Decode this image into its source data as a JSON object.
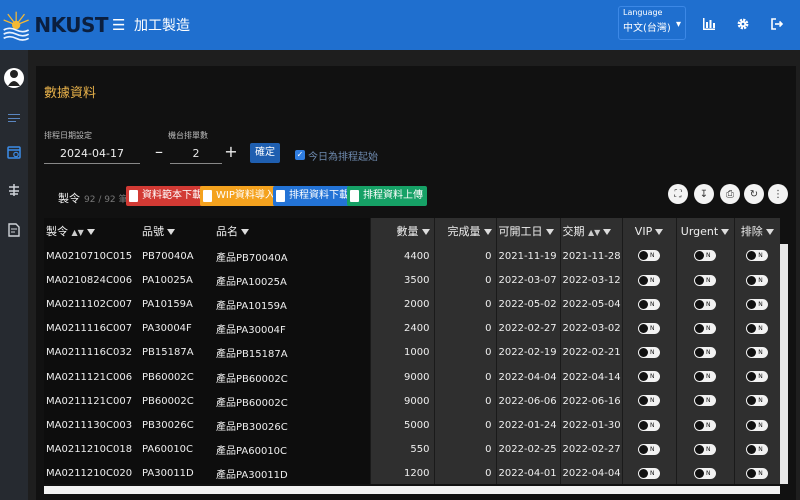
{
  "header": {
    "brand": "NKUST",
    "app_title": "加工製造",
    "language_label": "Language",
    "language_value": "中文(台灣)",
    "icons": [
      "menu-icon",
      "bar-chart-icon",
      "gear-icon",
      "logout-icon"
    ]
  },
  "sidebar": {
    "items": [
      "avatar",
      "list-icon",
      "calendar-icon",
      "adjust-icon",
      "document-icon"
    ]
  },
  "page": {
    "title": "數據資料",
    "date_label": "排程日期設定",
    "date_value": "2024-04-17",
    "machine_label": "機台排單數",
    "machine_value": "2",
    "confirm_label": "確定",
    "checkbox_label": "今日為排程起始",
    "checkbox_checked": true
  },
  "toolbar": {
    "title": "製令",
    "count": "92 / 92 筆",
    "buttons": [
      "資料範本下載",
      "WIP資料導入",
      "排程資料下載",
      "排程資料上傳"
    ]
  },
  "table": {
    "columns": [
      "製令",
      "品號",
      "品名",
      "數量",
      "完成量",
      "可開工日",
      "交期",
      "VIP",
      "Urgent",
      "排除"
    ],
    "toggle_text": "N",
    "rows": [
      [
        "MA0210710C015",
        "PB70040A",
        "產品PB70040A",
        "4400",
        "0",
        "2021-11-19",
        "2021-11-28"
      ],
      [
        "MA0210824C006",
        "PA10025A",
        "產品PA10025A",
        "3500",
        "0",
        "2022-03-07",
        "2022-03-12"
      ],
      [
        "MA0211102C007",
        "PA10159A",
        "產品PA10159A",
        "2000",
        "0",
        "2022-05-02",
        "2022-05-04"
      ],
      [
        "MA0211116C007",
        "PA30004F",
        "產品PA30004F",
        "2400",
        "0",
        "2022-02-27",
        "2022-03-02"
      ],
      [
        "MA0211116C032",
        "PB15187A",
        "產品PB15187A",
        "1000",
        "0",
        "2022-02-19",
        "2022-02-21"
      ],
      [
        "MA0211121C006",
        "PB60002C",
        "產品PB60002C",
        "9000",
        "0",
        "2022-04-04",
        "2022-04-14"
      ],
      [
        "MA0211121C007",
        "PB60002C",
        "產品PB60002C",
        "9000",
        "0",
        "2022-06-06",
        "2022-06-16"
      ],
      [
        "MA0211130C003",
        "PB30026C",
        "產品PB30026C",
        "5000",
        "0",
        "2022-01-24",
        "2022-01-30"
      ],
      [
        "MA0211210C018",
        "PA60010C",
        "產品PA60010C",
        "550",
        "0",
        "2022-02-25",
        "2022-02-27"
      ],
      [
        "MA0211210C020",
        "PA30011D",
        "產品PA30011D",
        "1200",
        "0",
        "2022-04-01",
        "2022-04-04"
      ]
    ]
  },
  "colors": {
    "header_bg": "#1f6fcf",
    "page_title": "#e7b14a",
    "btn_red": "#d23a34",
    "btn_orange": "#f4a21e",
    "btn_blue": "#2373d6",
    "btn_green": "#16a166"
  }
}
